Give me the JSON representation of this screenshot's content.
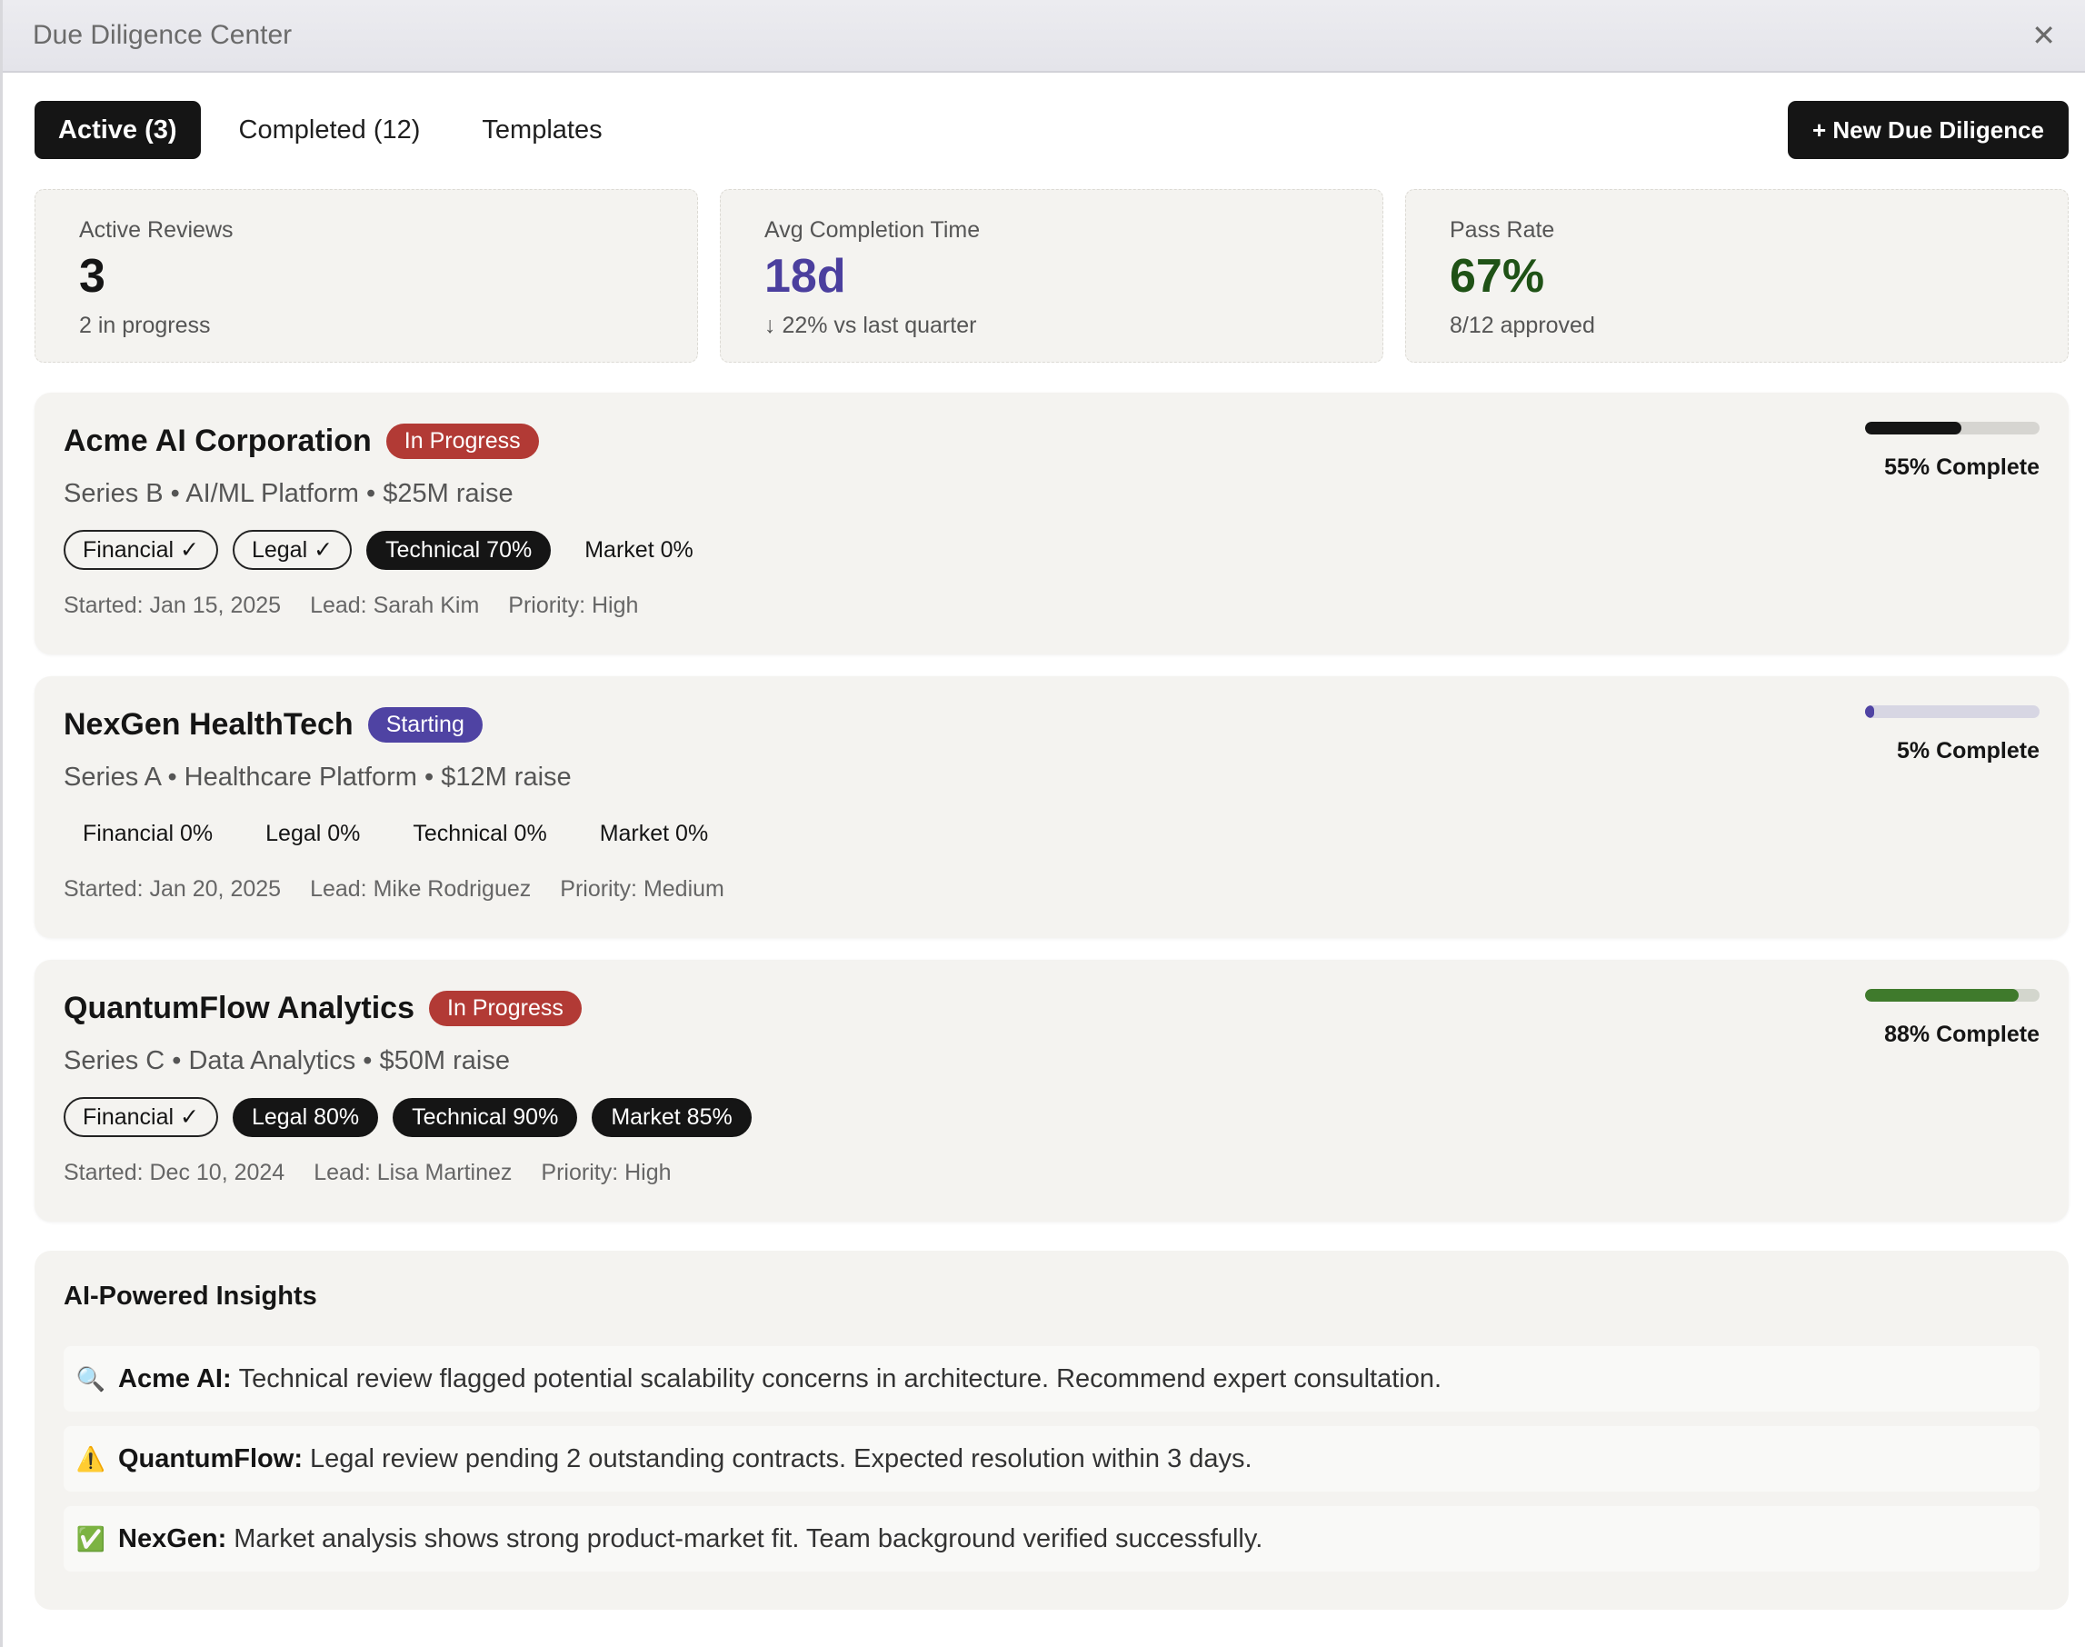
{
  "window": {
    "title": "Due Diligence Center",
    "close_icon": "close-icon"
  },
  "tabs": [
    {
      "label": "Active (3)",
      "active": true
    },
    {
      "label": "Completed (12)",
      "active": false
    },
    {
      "label": "Templates",
      "active": false
    }
  ],
  "new_button_label": "+ New Due Diligence",
  "stats": [
    {
      "label": "Active Reviews",
      "value": "3",
      "sub": "2 in progress",
      "color": "#151515"
    },
    {
      "label": "Avg Completion Time",
      "value": "18d",
      "sub": "↓ 22% vs last quarter",
      "color": "#4b3f9e"
    },
    {
      "label": "Pass Rate",
      "value": "67%",
      "sub": "8/12 approved",
      "color": "#1f5216"
    }
  ],
  "cards": [
    {
      "name": "Acme AI Corporation",
      "status": "In Progress",
      "status_color": "#b23a35",
      "meta": "Series B • AI/ML Platform • $25M raise",
      "chips": [
        {
          "label": "Financial ✓",
          "kind": "done"
        },
        {
          "label": "Legal ✓",
          "kind": "done"
        },
        {
          "label": "Technical 70%",
          "kind": "progress"
        },
        {
          "label": "Market 0%",
          "kind": "none"
        }
      ],
      "started": "Started: Jan 15, 2025",
      "lead": "Lead: Sarah Kim",
      "priority": "Priority: High",
      "progress": 0.55,
      "progress_label": "55% Complete",
      "bar_color": "#151515",
      "track_color": "#d6d5d1"
    },
    {
      "name": "NexGen HealthTech",
      "status": "Starting",
      "status_color": "#4f43a3",
      "meta": "Series A • Healthcare Platform • $12M raise",
      "chips": [
        {
          "label": "Financial 0%",
          "kind": "none"
        },
        {
          "label": "Legal 0%",
          "kind": "none"
        },
        {
          "label": "Technical 0%",
          "kind": "none"
        },
        {
          "label": "Market 0%",
          "kind": "none"
        }
      ],
      "started": "Started: Jan 20, 2025",
      "lead": "Lead: Mike Rodriguez",
      "priority": "Priority: Medium",
      "progress": 0.05,
      "progress_label": "5% Complete",
      "bar_color": "#4f43a3",
      "track_color": "#d7d6e3"
    },
    {
      "name": "QuantumFlow Analytics",
      "status": "In Progress",
      "status_color": "#b23a35",
      "meta": "Series C • Data Analytics • $50M raise",
      "chips": [
        {
          "label": "Financial ✓",
          "kind": "done"
        },
        {
          "label": "Legal 80%",
          "kind": "progress"
        },
        {
          "label": "Technical 90%",
          "kind": "progress"
        },
        {
          "label": "Market 85%",
          "kind": "progress"
        }
      ],
      "started": "Started: Dec 10, 2024",
      "lead": "Lead: Lisa Martinez",
      "priority": "Priority: High",
      "progress": 0.88,
      "progress_label": "88% Complete",
      "bar_color": "#3f7a2c",
      "track_color": "#d3d6cd"
    }
  ],
  "insights": {
    "title": "AI-Powered Insights",
    "items": [
      {
        "icon": "magnifier-icon",
        "glyph": "🔍",
        "who": "Acme AI:",
        "text": "Technical review flagged potential scalability concerns in architecture. Recommend expert consultation."
      },
      {
        "icon": "warning-icon",
        "glyph": "⚠️",
        "who": "QuantumFlow:",
        "text": "Legal review pending 2 outstanding contracts. Expected resolution within 3 days."
      },
      {
        "icon": "check-icon",
        "glyph": "✅",
        "who": "NexGen:",
        "text": "Market analysis shows strong product-market fit. Team background verified successfully."
      }
    ]
  }
}
